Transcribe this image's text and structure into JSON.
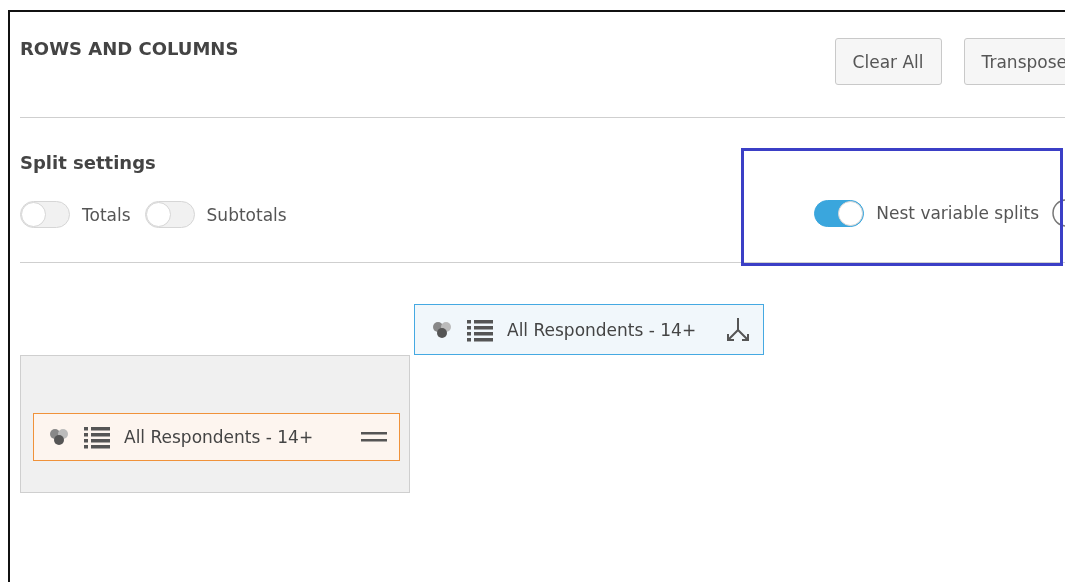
{
  "panel": {
    "title": "ROWS AND COLUMNS",
    "buttons": [
      "Clear All",
      "Transpose"
    ]
  },
  "split_settings": {
    "title": "Split settings",
    "toggles": [
      {
        "label": "Totals",
        "on": false
      },
      {
        "label": "Subtotals",
        "on": false
      }
    ],
    "nest_toggle": {
      "label": "Nest variable splits",
      "on": true,
      "highlighted": true
    }
  },
  "columns": [
    {
      "label": "All Respondents - 14+"
    }
  ],
  "rows": [
    {
      "label": "All Respondents - 14+"
    }
  ]
}
